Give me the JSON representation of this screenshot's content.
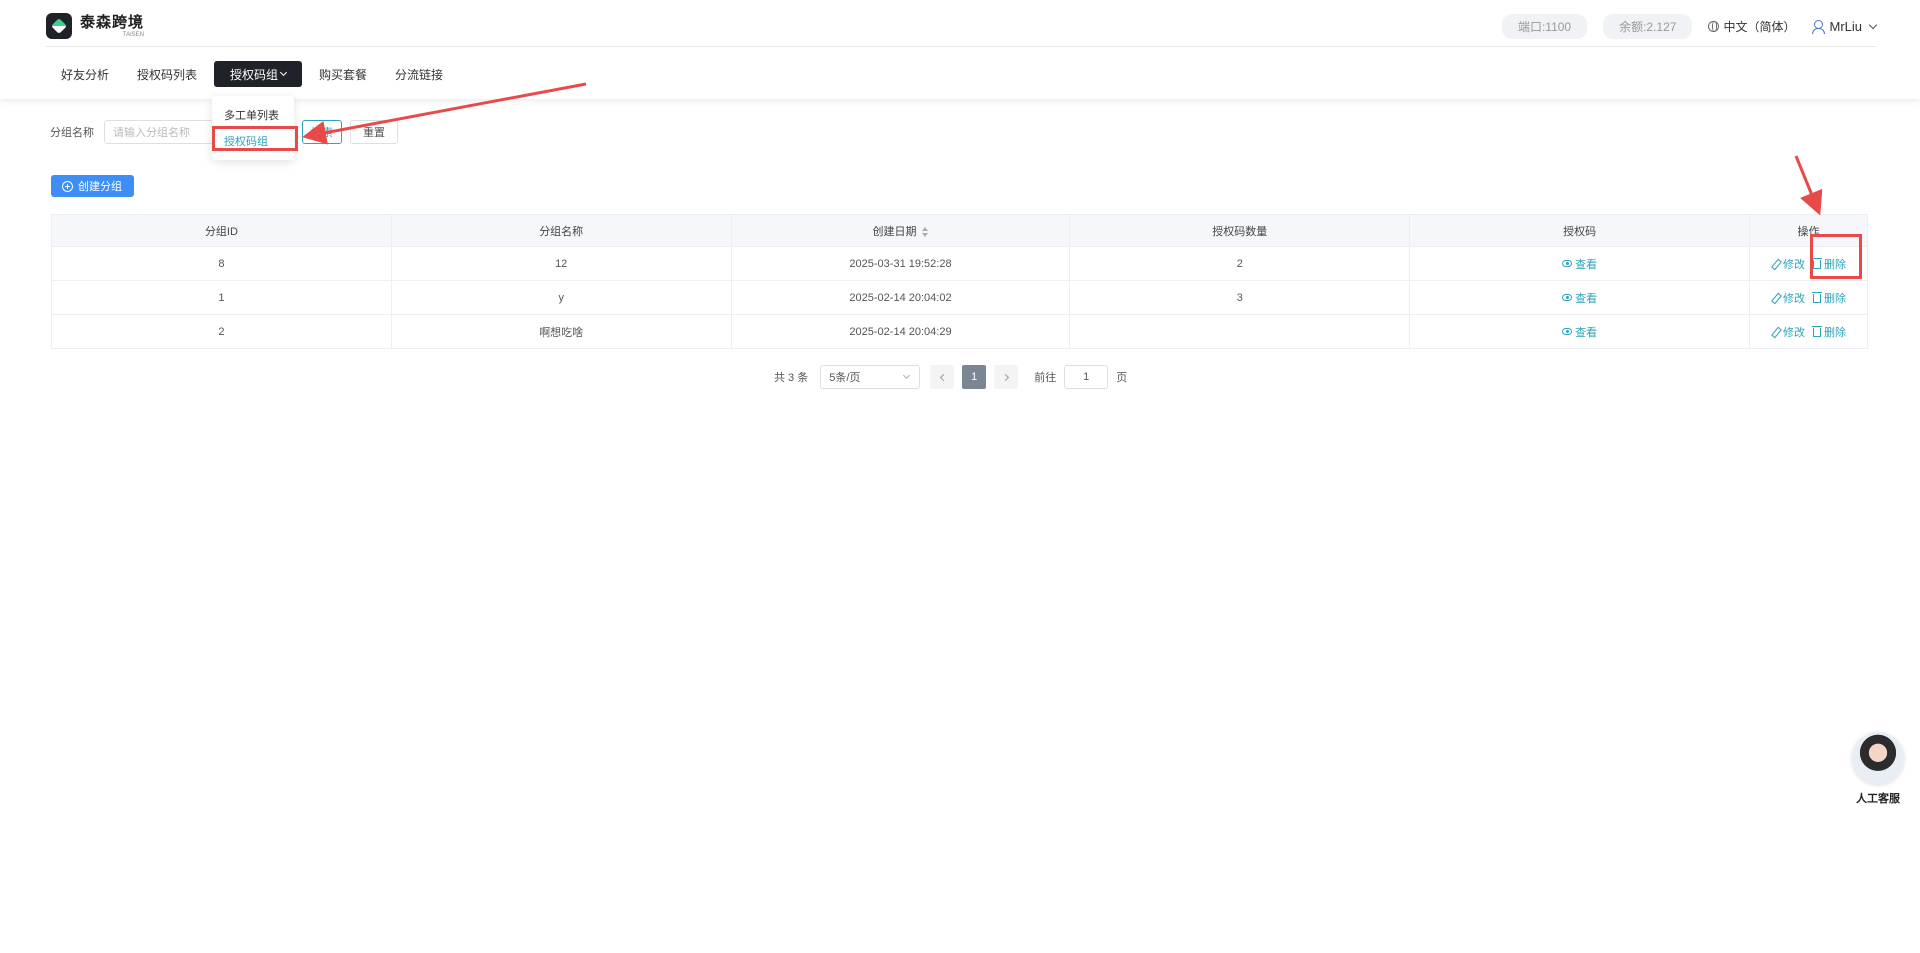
{
  "header": {
    "logo_name": "泰森跨境",
    "logo_sub": "TAISEN",
    "port": "端口:1100",
    "balance": "余额:2.127",
    "language": "中文（简体）",
    "username": "MrLiu"
  },
  "nav": {
    "items": [
      {
        "label": "好友分析"
      },
      {
        "label": "授权码列表"
      },
      {
        "label": "授权码组"
      },
      {
        "label": "购买套餐"
      },
      {
        "label": "分流链接"
      }
    ],
    "dropdown": [
      {
        "label": "多工单列表"
      },
      {
        "label": "授权码组"
      }
    ]
  },
  "filter": {
    "label": "分组名称",
    "placeholder": "请输入分组名称",
    "search_label": "搜索",
    "reset_label": "重置"
  },
  "create_label": "创建分组",
  "table": {
    "headers": [
      "分组ID",
      "分组名称",
      "创建日期",
      "授权码数量",
      "授权码",
      "操作"
    ],
    "rows": [
      {
        "id": "8",
        "name": "12",
        "date": "2025-03-31 19:52:28",
        "count": "2",
        "view": "查看",
        "edit": "修改",
        "delete": "删除"
      },
      {
        "id": "1",
        "name": "y",
        "date": "2025-02-14 20:04:02",
        "count": "3",
        "view": "查看",
        "edit": "修改",
        "delete": "删除"
      },
      {
        "id": "2",
        "name": "啊想吃啥",
        "date": "2025-02-14 20:04:29",
        "count": "",
        "view": "查看",
        "edit": "修改",
        "delete": "删除"
      }
    ]
  },
  "pagination": {
    "total": "共 3 条",
    "page_size": "5条/页",
    "current_page": "1",
    "goto_label": "前往",
    "goto_value": "1",
    "page_suffix": "页"
  },
  "service": {
    "label": "人工客服"
  },
  "colors": {
    "accent": "#2fa3b9",
    "primary_button": "#3d8ff5",
    "annotation": "#e84a4a"
  }
}
